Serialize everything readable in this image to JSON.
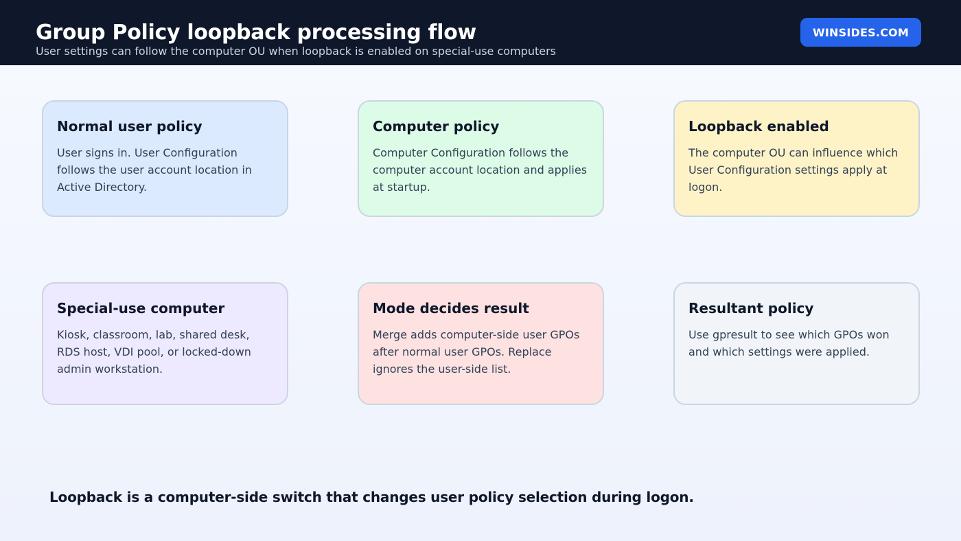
{
  "header": {
    "title": "Group Policy loopback processing flow",
    "subtitle": "User settings can follow the computer OU when loopback is enabled on special-use computers",
    "brand": "WINSIDES.COM",
    "background_color": "#0f172a",
    "brand_color": "#2563eb"
  },
  "cards": [
    {
      "title": "Normal user policy",
      "body": "User signs in. User Configuration follows the user account location in Active Directory.",
      "color": "#dbeafe"
    },
    {
      "title": "Computer policy",
      "body": "Computer Configuration follows the computer account location and applies at startup.",
      "color": "#dcfce7"
    },
    {
      "title": "Loopback enabled",
      "body": "The computer OU can influence which User Configuration settings apply at logon.",
      "color": "#fef3c7"
    },
    {
      "title": "Special-use computer",
      "body": "Kiosk, classroom, lab, shared desk, RDS host, VDI pool, or locked-down admin workstation.",
      "color": "#ede9fe"
    },
    {
      "title": "Mode decides result",
      "body": "Merge adds computer-side user GPOs after normal user GPOs. Replace ignores the user-side list.",
      "color": "#fee2e2"
    },
    {
      "title": "Resultant policy",
      "body": "Use gpresult to see which GPOs won and which settings were applied.",
      "color": "#f1f5f9"
    }
  ],
  "footer": {
    "note": "Loopback is a computer-side switch that changes user policy selection during logon."
  }
}
